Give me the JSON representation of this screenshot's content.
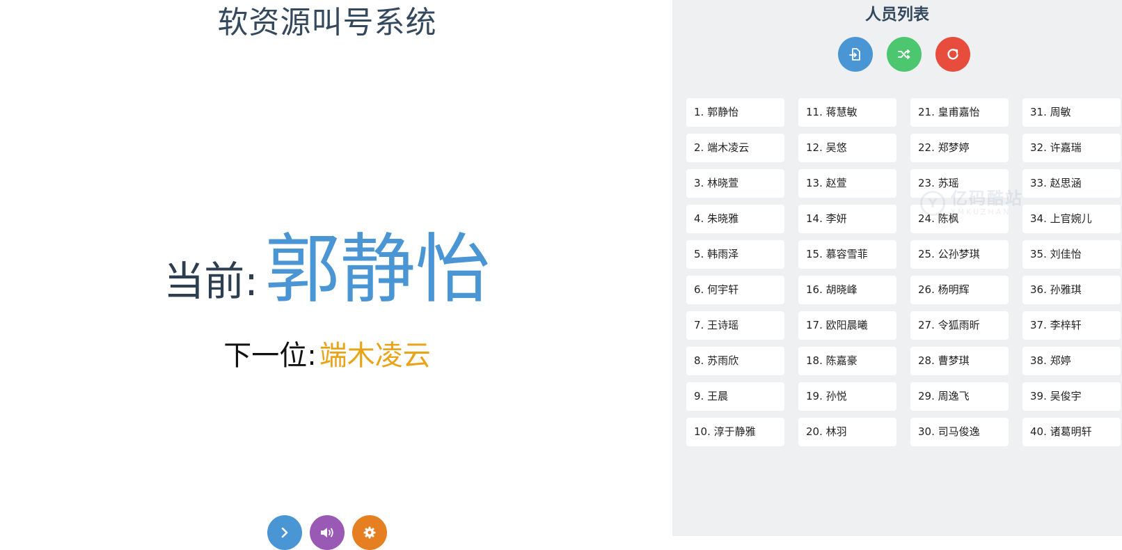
{
  "app": {
    "title": "软资源叫号系统"
  },
  "display": {
    "current_label": "当前:",
    "current_name": "郭静怡",
    "next_label": "下一位:",
    "next_name": "端木凌云"
  },
  "controls": [
    {
      "icon": "chevron-right-icon",
      "color": "#4a96d4"
    },
    {
      "icon": "volume-icon",
      "color": "#9b59b6"
    },
    {
      "icon": "gear-icon",
      "color": "#e67e22"
    }
  ],
  "list_panel": {
    "title": "人员列表",
    "actions": [
      {
        "icon": "import-file-icon",
        "color": "#4a96d4"
      },
      {
        "icon": "shuffle-icon",
        "color": "#4cc76f"
      },
      {
        "icon": "reset-icon",
        "color": "#e74c3c"
      }
    ],
    "people": [
      "1. 郭静怡",
      "2. 端木凌云",
      "3. 林晓萱",
      "4. 朱晓雅",
      "5. 韩雨泽",
      "6. 何宇轩",
      "7. 王诗瑶",
      "8. 苏雨欣",
      "9. 王晨",
      "10. 淳于静雅",
      "11. 蒋慧敏",
      "12. 吴悠",
      "13. 赵萱",
      "14. 李妍",
      "15. 慕容雪菲",
      "16. 胡晓峰",
      "17. 欧阳晨曦",
      "18. 陈嘉豪",
      "19. 孙悦",
      "20. 林羽",
      "21. 皇甫嘉怡",
      "22. 郑梦婷",
      "23. 苏瑶",
      "24. 陈枫",
      "25. 公孙梦琪",
      "26. 杨明辉",
      "27. 令狐雨昕",
      "28. 曹梦琪",
      "29. 周逸飞",
      "30. 司马俊逸",
      "31. 周敏",
      "32. 许嘉瑞",
      "33. 赵思涵",
      "34. 上官婉儿",
      "35. 刘佳怡",
      "36. 孙雅琪",
      "37. 李梓轩",
      "38. 郑婷",
      "39. 吴俊宇",
      "40. 诸葛明轩"
    ]
  },
  "watermark": {
    "logo": "Y",
    "text_cn": "亿码酷站",
    "text_en": "YMKUZHAN"
  }
}
